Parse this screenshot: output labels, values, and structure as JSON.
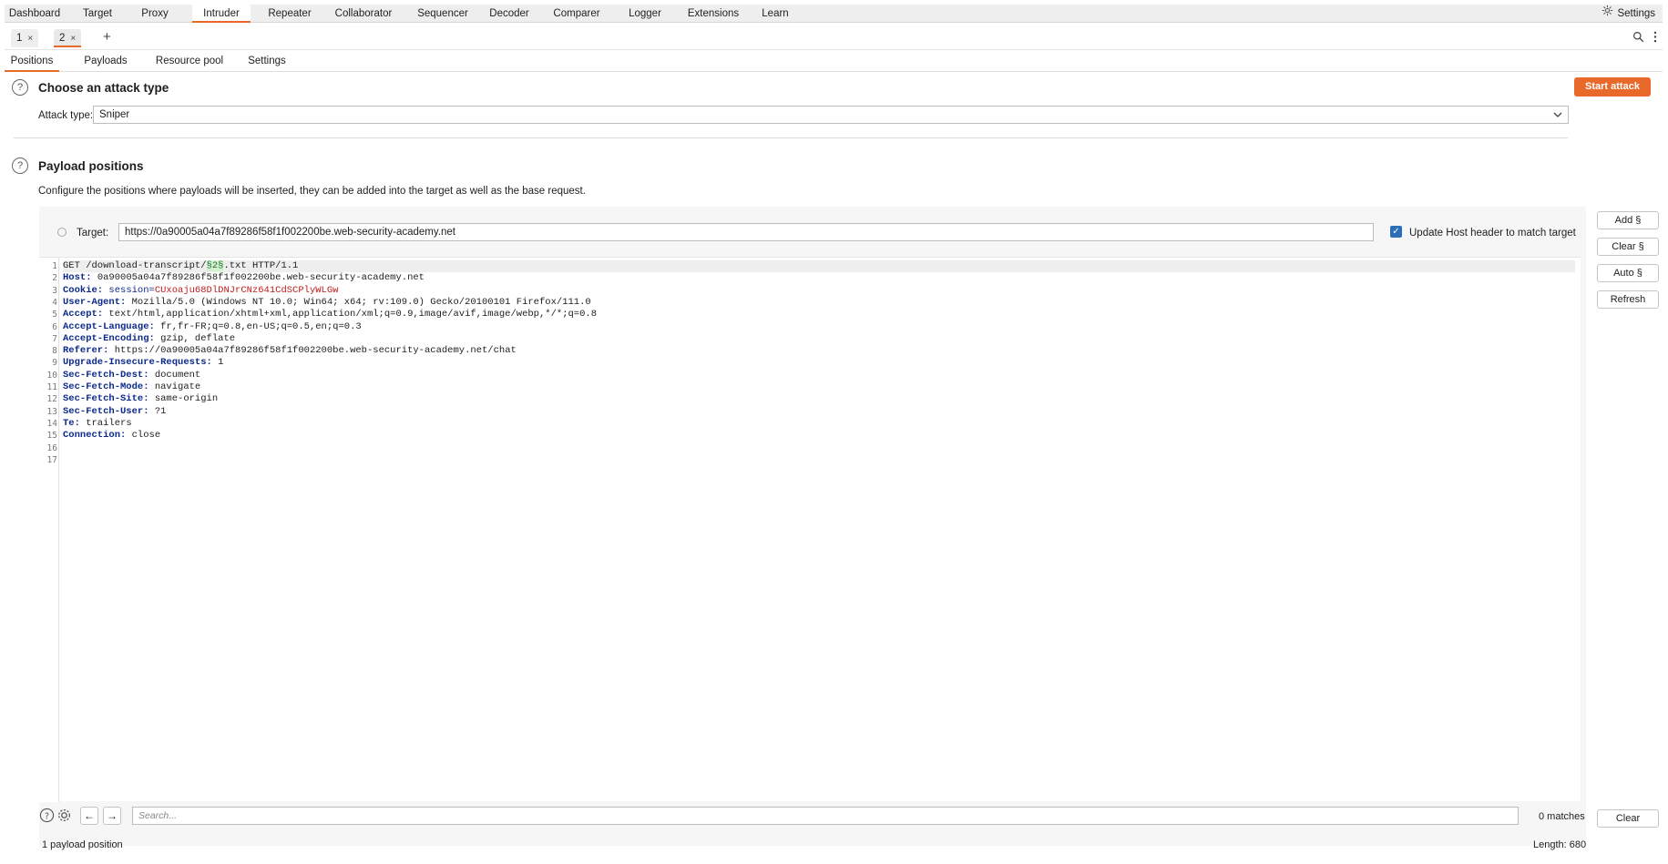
{
  "topnav": {
    "tabs": [
      "Dashboard",
      "Target",
      "Proxy",
      "Intruder",
      "Repeater",
      "Collaborator",
      "Sequencer",
      "Decoder",
      "Comparer",
      "Logger",
      "Extensions",
      "Learn"
    ],
    "active": "Intruder",
    "settings_label": "Settings"
  },
  "instance_tabs": [
    {
      "label": "1",
      "close": "×"
    },
    {
      "label": "2",
      "close": "×"
    }
  ],
  "add_tab": "+",
  "subtabs": {
    "items": [
      "Positions",
      "Payloads",
      "Resource pool",
      "Settings"
    ],
    "active": "Positions"
  },
  "attack_section": {
    "title": "Choose an attack type",
    "start_button": "Start attack",
    "attack_type_label": "Attack type:",
    "attack_type_value": "Sniper"
  },
  "positions_section": {
    "title": "Payload positions",
    "description": "Configure the positions where payloads will be inserted, they can be added into the target as well as the base request.",
    "target_label": "Target:",
    "target_value": "https://0a90005a04a7f89286f58f1f002200be.web-security-academy.net",
    "update_host_label": "Update Host header to match target",
    "update_host_checked": true
  },
  "side_buttons": [
    "Add §",
    "Clear §",
    "Auto §",
    "Refresh"
  ],
  "request": {
    "line_numbers": [
      "1",
      "2",
      "3",
      "4",
      "5",
      "6",
      "7",
      "8",
      "9",
      "10",
      "11",
      "12",
      "13",
      "14",
      "15",
      "16",
      "17"
    ],
    "request_line_pre": "GET /download-transcript/",
    "payload_marker": "§2§",
    "request_line_post": ".txt HTTP/1.1",
    "headers": [
      {
        "name": "Host:",
        "value": " 0a90005a04a7f89286f58f1f002200be.web-security-academy.net"
      },
      {
        "name": "Cookie:",
        "value": ""
      },
      {
        "name": "User-Agent:",
        "value": " Mozilla/5.0 (Windows NT 10.0; Win64; x64; rv:109.0) Gecko/20100101 Firefox/111.0"
      },
      {
        "name": "Accept:",
        "value": " text/html,application/xhtml+xml,application/xml;q=0.9,image/avif,image/webp,*/*;q=0.8"
      },
      {
        "name": "Accept-Language:",
        "value": " fr,fr-FR;q=0.8,en-US;q=0.5,en;q=0.3"
      },
      {
        "name": "Accept-Encoding:",
        "value": " gzip, deflate"
      },
      {
        "name": "Referer:",
        "value": " https://0a90005a04a7f89286f58f1f002200be.web-security-academy.net/chat"
      },
      {
        "name": "Upgrade-Insecure-Requests:",
        "value": " 1"
      },
      {
        "name": "Sec-Fetch-Dest:",
        "value": " document"
      },
      {
        "name": "Sec-Fetch-Mode:",
        "value": " navigate"
      },
      {
        "name": "Sec-Fetch-Site:",
        "value": " same-origin"
      },
      {
        "name": "Sec-Fetch-User:",
        "value": " ?1"
      },
      {
        "name": "Te:",
        "value": " trailers"
      },
      {
        "name": "Connection:",
        "value": " close"
      }
    ],
    "cookie_name": " session=",
    "cookie_value": "CUxoaju68DlDNJrCNz641CdSCPlyWLGw"
  },
  "search": {
    "placeholder": "Search...",
    "matches": "0 matches",
    "clear_label": "Clear"
  },
  "status": {
    "positions": "1 payload position",
    "length": "Length: 680"
  },
  "colors": {
    "accent": "#e8692a",
    "header_key": "#0c2a8c",
    "cookie_value": "#c11a1a",
    "payload_bg": "#d4f1cf"
  }
}
